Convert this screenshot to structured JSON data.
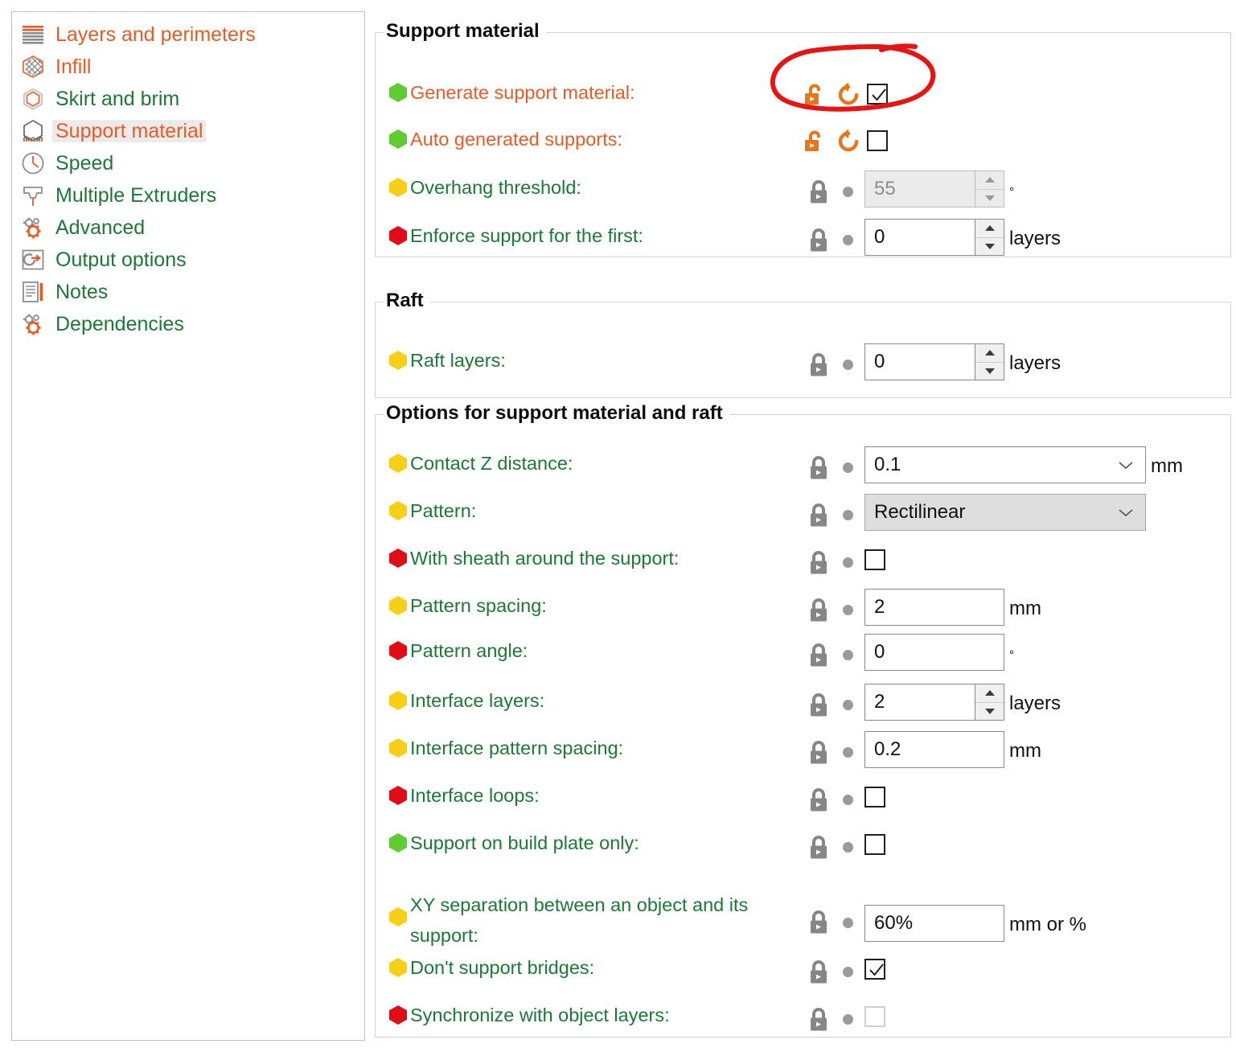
{
  "sidebar": {
    "items": [
      {
        "label": "Layers and perimeters",
        "icon": "layers-icon",
        "color": "orange",
        "selected": false
      },
      {
        "label": "Infill",
        "icon": "infill-icon",
        "color": "orange",
        "selected": false
      },
      {
        "label": "Skirt and brim",
        "icon": "skirt-brim-icon",
        "color": "green",
        "selected": false
      },
      {
        "label": "Support material",
        "icon": "support-material-icon",
        "color": "orange",
        "selected": true
      },
      {
        "label": "Speed",
        "icon": "speed-clock-icon",
        "color": "green",
        "selected": false
      },
      {
        "label": "Multiple Extruders",
        "icon": "extruder-icon",
        "color": "green",
        "selected": false
      },
      {
        "label": "Advanced",
        "icon": "gears-icon",
        "color": "green",
        "selected": false
      },
      {
        "label": "Output options",
        "icon": "output-export-icon",
        "color": "green",
        "selected": false
      },
      {
        "label": "Notes",
        "icon": "notes-document-icon",
        "color": "green",
        "selected": false
      },
      {
        "label": "Dependencies",
        "icon": "gears-icon",
        "color": "green",
        "selected": false
      }
    ]
  },
  "colors": {
    "orange_label": "#ed5a24",
    "green_label": "#1a7a33",
    "bullet_green": "#5ecc32",
    "bullet_yellow": "#f7cf16",
    "bullet_red": "#e00c16",
    "lock_orange": "#e8751a",
    "lock_gray": "#868686",
    "annotation_red": "#e81313"
  },
  "groups": [
    {
      "title": "Support material",
      "rows": [
        {
          "label": "Generate support material:",
          "label_color": "orange",
          "bullet": "green",
          "control": "checkbox",
          "value": true,
          "lock": "unlocked-orange",
          "reset": true,
          "annotated": true
        },
        {
          "label": "Auto generated supports:",
          "label_color": "orange",
          "bullet": "green",
          "control": "checkbox",
          "value": false,
          "lock": "unlocked-orange",
          "reset": true
        },
        {
          "label": "Overhang threshold:",
          "label_color": "green",
          "bullet": "yellow",
          "control": "spinner",
          "value": "55",
          "unit": "°",
          "lock": "locked-gray",
          "dot": true,
          "disabled": true
        },
        {
          "label": "Enforce support for the first:",
          "label_color": "green",
          "bullet": "red",
          "control": "spinner",
          "value": "0",
          "unit": "layers",
          "lock": "locked-gray",
          "dot": true
        }
      ]
    },
    {
      "title": "Raft",
      "rows": [
        {
          "label": "Raft layers:",
          "label_color": "green",
          "bullet": "yellow",
          "control": "spinner",
          "value": "0",
          "unit": "layers",
          "lock": "locked-gray",
          "dot": true
        }
      ]
    },
    {
      "title": "Options for support material and raft",
      "rows": [
        {
          "label": "Contact Z distance:",
          "label_color": "green",
          "bullet": "yellow",
          "control": "combo",
          "value": "0.1",
          "unit": "mm",
          "lock": "locked-gray",
          "dot": true
        },
        {
          "label": "Pattern:",
          "label_color": "green",
          "bullet": "yellow",
          "control": "combo",
          "value": "Rectilinear",
          "unit": "",
          "lock": "locked-gray",
          "dot": true,
          "shaded": true
        },
        {
          "label": "With sheath around the support:",
          "label_color": "green",
          "bullet": "red",
          "control": "checkbox",
          "value": false,
          "lock": "locked-gray",
          "dot": true
        },
        {
          "label": "Pattern spacing:",
          "label_color": "green",
          "bullet": "yellow",
          "control": "text",
          "value": "2",
          "unit": "mm",
          "lock": "locked-gray",
          "dot": true
        },
        {
          "label": "Pattern angle:",
          "label_color": "green",
          "bullet": "red",
          "control": "text",
          "value": "0",
          "unit": "°",
          "lock": "locked-gray",
          "dot": true
        },
        {
          "label": "Interface layers:",
          "label_color": "green",
          "bullet": "yellow",
          "control": "spinner",
          "value": "2",
          "unit": "layers",
          "lock": "locked-gray",
          "dot": true
        },
        {
          "label": "Interface pattern spacing:",
          "label_color": "green",
          "bullet": "yellow",
          "control": "text",
          "value": "0.2",
          "unit": "mm",
          "lock": "locked-gray",
          "dot": true
        },
        {
          "label": "Interface loops:",
          "label_color": "green",
          "bullet": "red",
          "control": "checkbox",
          "value": false,
          "lock": "locked-gray",
          "dot": true
        },
        {
          "label": "Support on build plate only:",
          "label_color": "green",
          "bullet": "green",
          "control": "checkbox",
          "value": false,
          "lock": "locked-gray",
          "dot": true
        },
        {
          "label": "XY separation between an object and its support:",
          "label_color": "green",
          "bullet": "yellow",
          "control": "text",
          "value": "60%",
          "unit": "mm or %",
          "lock": "locked-gray",
          "dot": true,
          "two_line": true
        },
        {
          "label": "Don't support bridges:",
          "label_color": "green",
          "bullet": "yellow",
          "control": "checkbox",
          "value": true,
          "lock": "locked-gray",
          "dot": true
        },
        {
          "label": "Synchronize with object layers:",
          "label_color": "green",
          "bullet": "red",
          "control": "checkbox",
          "value": false,
          "lock": "locked-gray",
          "dot": true,
          "disabled": true
        }
      ]
    }
  ]
}
